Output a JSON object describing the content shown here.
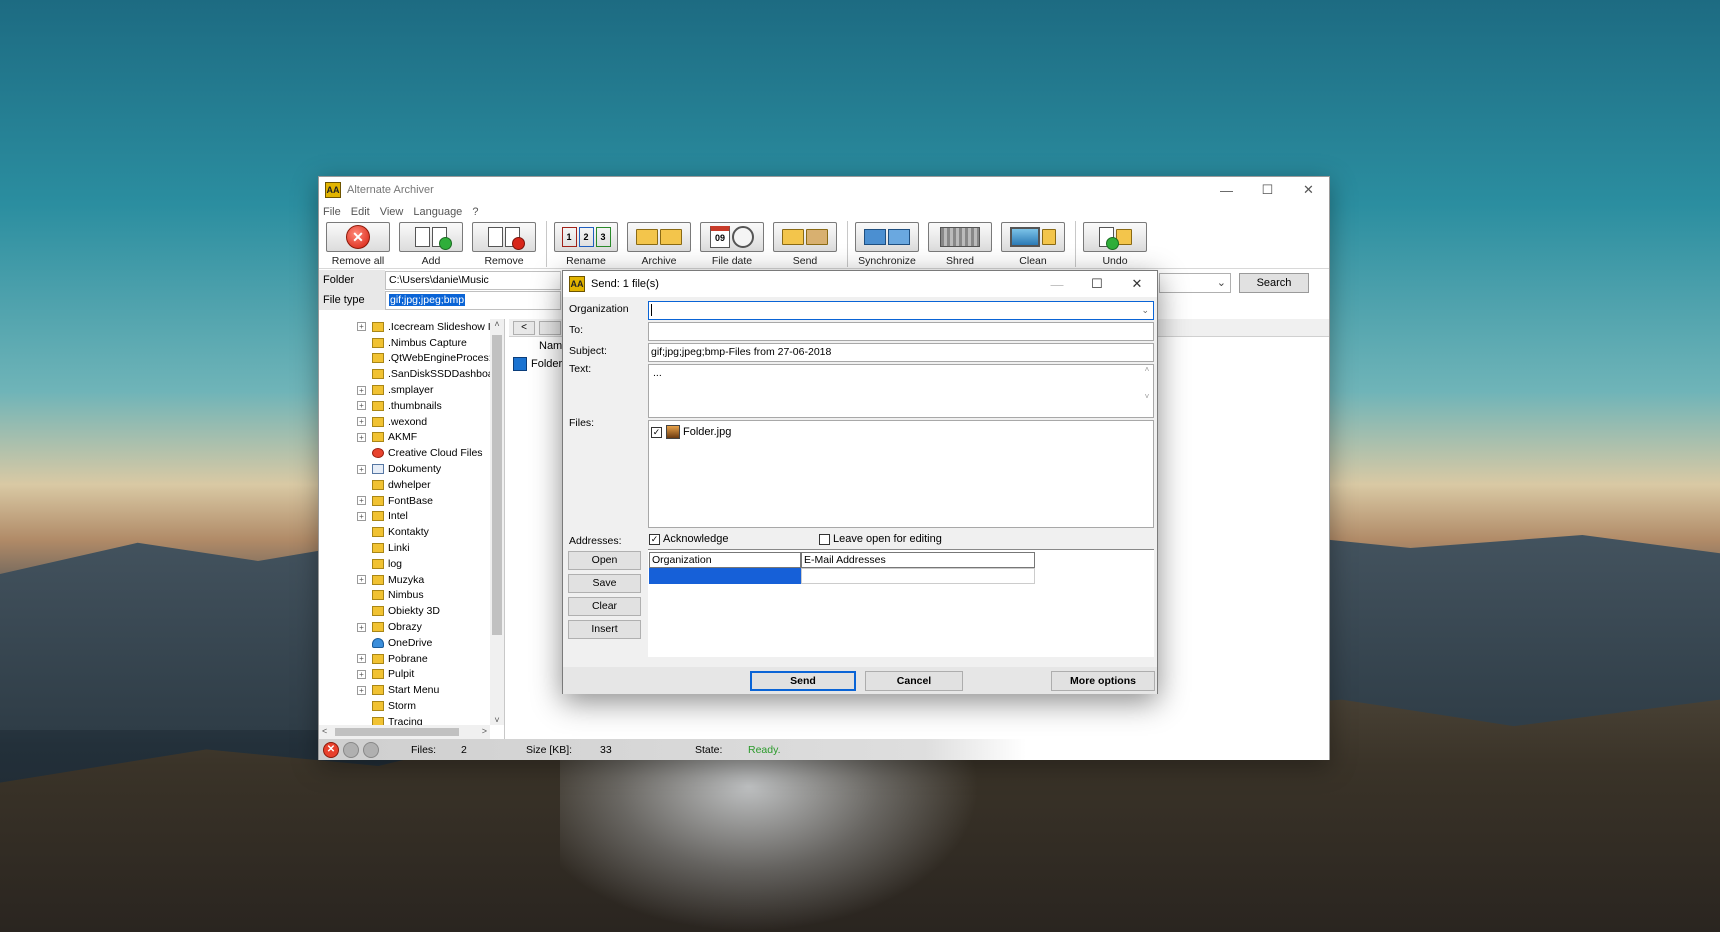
{
  "main_window": {
    "title": "Alternate Archiver",
    "menu": [
      "File",
      "Edit",
      "View",
      "Language",
      "?"
    ],
    "toolbar": {
      "group1": [
        {
          "label": "Remove all",
          "icon": "remove-all-icon"
        },
        {
          "label": "Add",
          "icon": "add-icon"
        },
        {
          "label": "Remove",
          "icon": "remove-icon"
        }
      ],
      "group2": [
        {
          "label": "Rename",
          "icon": "rename-icon"
        },
        {
          "label": "Archive",
          "icon": "archive-icon"
        },
        {
          "label": "File date",
          "icon": "file-date-icon"
        },
        {
          "label": "Send",
          "icon": "send-icon"
        }
      ],
      "group3": [
        {
          "label": "Synchronize",
          "icon": "synchronize-icon"
        },
        {
          "label": "Shred",
          "icon": "shred-icon"
        },
        {
          "label": "Clean",
          "icon": "clean-icon"
        }
      ],
      "group4": [
        {
          "label": "Undo",
          "icon": "undo-icon"
        }
      ],
      "calendar_day": "09"
    },
    "folder_label": "Folder",
    "folder_value": "C:\\Users\\danie\\Music",
    "filetype_label": "File type",
    "filetype_value": "gif;jpg;jpeg;bmp",
    "search_label": "Search",
    "tree": [
      {
        "name": ".Icecream Slideshow I",
        "expand": true,
        "icon": "folder"
      },
      {
        "name": ".Nimbus Capture",
        "expand": false,
        "icon": "folder"
      },
      {
        "name": ".QtWebEngineProces:",
        "expand": false,
        "icon": "folder"
      },
      {
        "name": ".SanDiskSSDDashboa",
        "expand": false,
        "icon": "folder"
      },
      {
        "name": ".smplayer",
        "expand": true,
        "icon": "folder"
      },
      {
        "name": ".thumbnails",
        "expand": true,
        "icon": "folder"
      },
      {
        "name": ".wexond",
        "expand": true,
        "icon": "folder"
      },
      {
        "name": "AKMF",
        "expand": true,
        "icon": "folder"
      },
      {
        "name": "Creative Cloud Files",
        "expand": false,
        "icon": "creative-cloud"
      },
      {
        "name": "Dokumenty",
        "expand": true,
        "icon": "documents"
      },
      {
        "name": "dwhelper",
        "expand": false,
        "icon": "folder"
      },
      {
        "name": "FontBase",
        "expand": true,
        "icon": "folder"
      },
      {
        "name": "Intel",
        "expand": true,
        "icon": "folder"
      },
      {
        "name": "Kontakty",
        "expand": false,
        "icon": "folder"
      },
      {
        "name": "Linki",
        "expand": false,
        "icon": "folder"
      },
      {
        "name": "log",
        "expand": false,
        "icon": "folder"
      },
      {
        "name": "Muzyka",
        "expand": true,
        "icon": "folder"
      },
      {
        "name": "Nimbus",
        "expand": false,
        "icon": "folder"
      },
      {
        "name": "Obiekty 3D",
        "expand": false,
        "icon": "folder"
      },
      {
        "name": "Obrazy",
        "expand": true,
        "icon": "folder"
      },
      {
        "name": "OneDrive",
        "expand": false,
        "icon": "onedrive"
      },
      {
        "name": "Pobrane",
        "expand": true,
        "icon": "folder"
      },
      {
        "name": "Pulpit",
        "expand": true,
        "icon": "folder"
      },
      {
        "name": "Start Menu",
        "expand": true,
        "icon": "folder"
      },
      {
        "name": "Storm",
        "expand": false,
        "icon": "folder"
      },
      {
        "name": "Tracing",
        "expand": false,
        "icon": "folder"
      }
    ],
    "list": {
      "back_label": "<",
      "column_name": "Nam",
      "rows": [
        "Folder"
      ]
    },
    "status": {
      "files_label": "Files:",
      "files_value": "2",
      "size_label": "Size [KB]:",
      "size_value": "33",
      "state_label": "State:",
      "state_value": "Ready."
    }
  },
  "send_dialog": {
    "title": "Send: 1 file(s)",
    "organization_label": "Organization",
    "organization_value": "",
    "to_label": "To:",
    "to_value": "",
    "subject_label": "Subject:",
    "subject_value": "gif;jpg;jpeg;bmp-Files from 27-06-2018",
    "text_label": "Text:",
    "text_value": "...",
    "files_label": "Files:",
    "files": [
      {
        "name": "Folder.jpg",
        "checked": true
      }
    ],
    "addresses_label": "Addresses:",
    "acknowledge_label": "Acknowledge",
    "acknowledge_checked": true,
    "leave_open_label": "Leave open for editing",
    "leave_open_checked": false,
    "side_buttons": [
      "Open",
      "Save",
      "Clear",
      "Insert"
    ],
    "grid_columns": [
      "Organization",
      "E-Mail Addresses"
    ],
    "send_button": "Send",
    "cancel_button": "Cancel",
    "more_options_button": "More options"
  }
}
